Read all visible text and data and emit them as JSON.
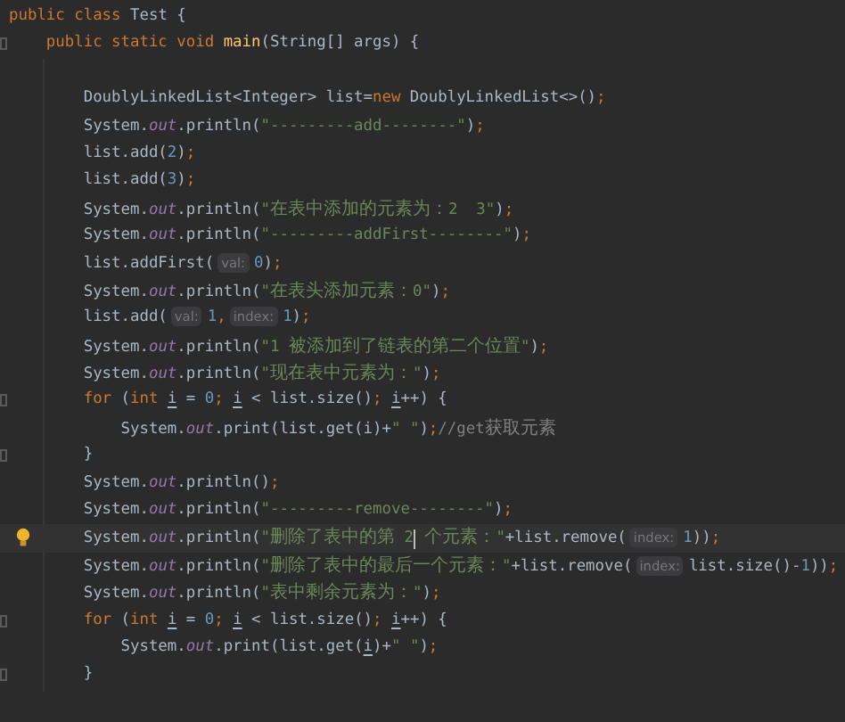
{
  "editor": {
    "signature_lines": [
      {
        "tokens": [
          {
            "kind": "kw",
            "text": "public class "
          },
          {
            "kind": "plain",
            "text": "Test {"
          }
        ]
      },
      {
        "gutter": {
          "kind": "fold"
        },
        "tokens": [
          {
            "kind": "kw",
            "text": "    public static void "
          },
          {
            "kind": "method",
            "text": "main"
          },
          {
            "kind": "plain",
            "text": "(String[] args) {"
          }
        ]
      }
    ],
    "body_lines": [
      {
        "tokens": [
          {
            "kind": "plain",
            "text": "        DoublyLinkedList<Integer> list="
          },
          {
            "kind": "kw",
            "text": "new"
          },
          {
            "kind": "plain",
            "text": " DoublyLinkedList<>()"
          },
          {
            "kind": "kw",
            "text": ";"
          }
        ]
      },
      {
        "tokens": [
          {
            "kind": "plain",
            "text": "        System."
          },
          {
            "kind": "field",
            "text": "out"
          },
          {
            "kind": "plain",
            "text": ".println("
          },
          {
            "kind": "str",
            "text": "\"---------add--------\""
          },
          {
            "kind": "plain",
            "text": ")"
          },
          {
            "kind": "kw",
            "text": ";"
          }
        ]
      },
      {
        "tokens": [
          {
            "kind": "plain",
            "text": "        list.add("
          },
          {
            "kind": "num",
            "text": "2"
          },
          {
            "kind": "plain",
            "text": ")"
          },
          {
            "kind": "kw",
            "text": ";"
          }
        ]
      },
      {
        "tokens": [
          {
            "kind": "plain",
            "text": "        list.add("
          },
          {
            "kind": "num",
            "text": "3"
          },
          {
            "kind": "plain",
            "text": ")"
          },
          {
            "kind": "kw",
            "text": ";"
          }
        ]
      },
      {
        "tokens": [
          {
            "kind": "plain",
            "text": "        System."
          },
          {
            "kind": "field",
            "text": "out"
          },
          {
            "kind": "plain",
            "text": ".println("
          },
          {
            "kind": "str",
            "text": "\"在表中添加的元素为：2  3\""
          },
          {
            "kind": "plain",
            "text": ")"
          },
          {
            "kind": "kw",
            "text": ";"
          }
        ]
      },
      {
        "tokens": [
          {
            "kind": "plain",
            "text": "        System."
          },
          {
            "kind": "field",
            "text": "out"
          },
          {
            "kind": "plain",
            "text": ".println("
          },
          {
            "kind": "str",
            "text": "\"---------addFirst--------\""
          },
          {
            "kind": "plain",
            "text": ")"
          },
          {
            "kind": "kw",
            "text": ";"
          }
        ]
      },
      {
        "tokens": [
          {
            "kind": "plain",
            "text": "        list.addFirst("
          },
          {
            "kind": "hint",
            "text": "val:"
          },
          {
            "kind": "num",
            "text": "0"
          },
          {
            "kind": "plain",
            "text": ")"
          },
          {
            "kind": "kw",
            "text": ";"
          }
        ]
      },
      {
        "tokens": [
          {
            "kind": "plain",
            "text": "        System."
          },
          {
            "kind": "field",
            "text": "out"
          },
          {
            "kind": "plain",
            "text": ".println("
          },
          {
            "kind": "str",
            "text": "\"在表头添加元素：0\""
          },
          {
            "kind": "plain",
            "text": ")"
          },
          {
            "kind": "kw",
            "text": ";"
          }
        ]
      },
      {
        "tokens": [
          {
            "kind": "plain",
            "text": "        list.add("
          },
          {
            "kind": "hint",
            "text": "val:"
          },
          {
            "kind": "num",
            "text": "1"
          },
          {
            "kind": "kw",
            "text": ","
          },
          {
            "kind": "hint",
            "text": "index:"
          },
          {
            "kind": "num",
            "text": "1"
          },
          {
            "kind": "plain",
            "text": ")"
          },
          {
            "kind": "kw",
            "text": ";"
          }
        ]
      },
      {
        "tokens": [
          {
            "kind": "plain",
            "text": "        System."
          },
          {
            "kind": "field",
            "text": "out"
          },
          {
            "kind": "plain",
            "text": ".println("
          },
          {
            "kind": "str",
            "text": "\"1 被添加到了链表的第二个位置\""
          },
          {
            "kind": "plain",
            "text": ")"
          },
          {
            "kind": "kw",
            "text": ";"
          }
        ]
      },
      {
        "tokens": [
          {
            "kind": "plain",
            "text": "        System."
          },
          {
            "kind": "field",
            "text": "out"
          },
          {
            "kind": "plain",
            "text": ".println("
          },
          {
            "kind": "str",
            "text": "\"现在表中元素为：\""
          },
          {
            "kind": "plain",
            "text": ")"
          },
          {
            "kind": "kw",
            "text": ";"
          }
        ]
      },
      {
        "gutter": {
          "kind": "fold"
        },
        "tokens": [
          {
            "kind": "kw",
            "text": "        for"
          },
          {
            "kind": "plain",
            "text": " ("
          },
          {
            "kind": "kw",
            "text": "int "
          },
          {
            "kind": "var",
            "text": "i"
          },
          {
            "kind": "plain",
            "text": " = "
          },
          {
            "kind": "num",
            "text": "0"
          },
          {
            "kind": "kw",
            "text": "; "
          },
          {
            "kind": "var",
            "text": "i"
          },
          {
            "kind": "plain",
            "text": " < list.size()"
          },
          {
            "kind": "kw",
            "text": "; "
          },
          {
            "kind": "var",
            "text": "i"
          },
          {
            "kind": "plain",
            "text": "++) {"
          }
        ]
      },
      {
        "tokens": [
          {
            "kind": "plain",
            "text": "            System."
          },
          {
            "kind": "field",
            "text": "out"
          },
          {
            "kind": "plain",
            "text": ".print(list.get(i)+"
          },
          {
            "kind": "str",
            "text": "\" \""
          },
          {
            "kind": "plain",
            "text": ")"
          },
          {
            "kind": "kw",
            "text": ";"
          },
          {
            "kind": "comment",
            "text": "//get获取元素"
          }
        ]
      },
      {
        "gutter": {
          "kind": "fold"
        },
        "tokens": [
          {
            "kind": "plain",
            "text": "        }"
          }
        ]
      },
      {
        "tokens": [
          {
            "kind": "plain",
            "text": "        System."
          },
          {
            "kind": "field",
            "text": "out"
          },
          {
            "kind": "plain",
            "text": ".println()"
          },
          {
            "kind": "kw",
            "text": ";"
          }
        ]
      },
      {
        "tokens": [
          {
            "kind": "plain",
            "text": "        System."
          },
          {
            "kind": "field",
            "text": "out"
          },
          {
            "kind": "plain",
            "text": ".println("
          },
          {
            "kind": "str",
            "text": "\"---------remove--------\""
          },
          {
            "kind": "plain",
            "text": ")"
          },
          {
            "kind": "kw",
            "text": ";"
          }
        ]
      },
      {
        "gutter": {
          "kind": "bulb"
        },
        "current": true,
        "tokens": [
          {
            "kind": "plain",
            "text": "        System."
          },
          {
            "kind": "field",
            "text": "out"
          },
          {
            "kind": "plain",
            "text": ".println("
          },
          {
            "kind": "str",
            "text": "\"删除了表中的第 2",
            "caret": true
          },
          {
            "kind": "str",
            "text": " 个元素：\""
          },
          {
            "kind": "plain",
            "text": "+list.remove("
          },
          {
            "kind": "hint",
            "text": "index:"
          },
          {
            "kind": "num",
            "text": "1"
          },
          {
            "kind": "plain",
            "text": "))"
          },
          {
            "kind": "kw",
            "text": ";"
          }
        ]
      },
      {
        "tokens": [
          {
            "kind": "plain",
            "text": "        System."
          },
          {
            "kind": "field",
            "text": "out"
          },
          {
            "kind": "plain",
            "text": ".println("
          },
          {
            "kind": "str",
            "text": "\"删除了表中的最后一个元素：\""
          },
          {
            "kind": "plain",
            "text": "+list.remove("
          },
          {
            "kind": "hint",
            "text": "index:"
          },
          {
            "kind": "plain",
            "text": "list.size()-"
          },
          {
            "kind": "num",
            "text": "1"
          },
          {
            "kind": "plain",
            "text": "))"
          },
          {
            "kind": "kw",
            "text": ";"
          }
        ]
      },
      {
        "tokens": [
          {
            "kind": "plain",
            "text": "        System."
          },
          {
            "kind": "field",
            "text": "out"
          },
          {
            "kind": "plain",
            "text": ".println("
          },
          {
            "kind": "str",
            "text": "\"表中剩余元素为：\""
          },
          {
            "kind": "plain",
            "text": ")"
          },
          {
            "kind": "kw",
            "text": ";"
          }
        ]
      },
      {
        "gutter": {
          "kind": "fold"
        },
        "tokens": [
          {
            "kind": "kw",
            "text": "        for"
          },
          {
            "kind": "plain",
            "text": " ("
          },
          {
            "kind": "kw",
            "text": "int "
          },
          {
            "kind": "var",
            "text": "i"
          },
          {
            "kind": "plain",
            "text": " = "
          },
          {
            "kind": "num",
            "text": "0"
          },
          {
            "kind": "kw",
            "text": "; "
          },
          {
            "kind": "var",
            "text": "i"
          },
          {
            "kind": "plain",
            "text": " < list.size()"
          },
          {
            "kind": "kw",
            "text": "; "
          },
          {
            "kind": "var",
            "text": "i"
          },
          {
            "kind": "plain",
            "text": "++) {"
          }
        ]
      },
      {
        "tokens": [
          {
            "kind": "plain",
            "text": "            System."
          },
          {
            "kind": "field",
            "text": "out"
          },
          {
            "kind": "plain",
            "text": ".print(list.get("
          },
          {
            "kind": "var",
            "text": "i"
          },
          {
            "kind": "plain",
            "text": ")+"
          },
          {
            "kind": "str",
            "text": "\" \""
          },
          {
            "kind": "plain",
            "text": ")"
          },
          {
            "kind": "kw",
            "text": ";"
          }
        ]
      },
      {
        "gutter": {
          "kind": "fold"
        },
        "tokens": [
          {
            "kind": "plain",
            "text": "        }"
          }
        ]
      }
    ]
  }
}
